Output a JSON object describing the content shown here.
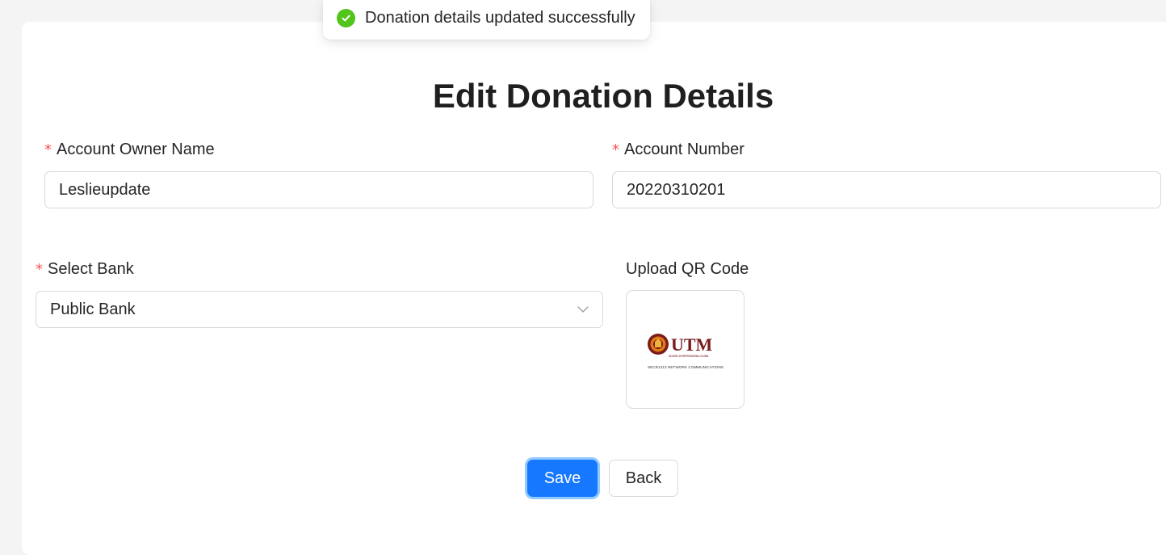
{
  "toast": {
    "message": "Donation details updated successfully",
    "icon": "check-circle-icon",
    "color": "#52c41a"
  },
  "page": {
    "title": "Edit Donation Details"
  },
  "form": {
    "required_mark": "*",
    "owner_name": {
      "label": "Account Owner Name",
      "value": "Leslieupdate"
    },
    "account_number": {
      "label": "Account Number",
      "value": "20220310201"
    },
    "bank": {
      "label": "Select Bank",
      "value": "Public Bank",
      "icon": "chevron-down-icon"
    },
    "qr": {
      "label": "Upload QR Code",
      "logo_text": "UTM",
      "logo_motto": "INOVATIF • ENTREPRENEURIAL • GLOBAL",
      "caption": "SECR1213 NETWORK COMMUNICATIONS"
    }
  },
  "actions": {
    "save_label": "Save",
    "back_label": "Back",
    "primary_color": "#1677ff"
  }
}
